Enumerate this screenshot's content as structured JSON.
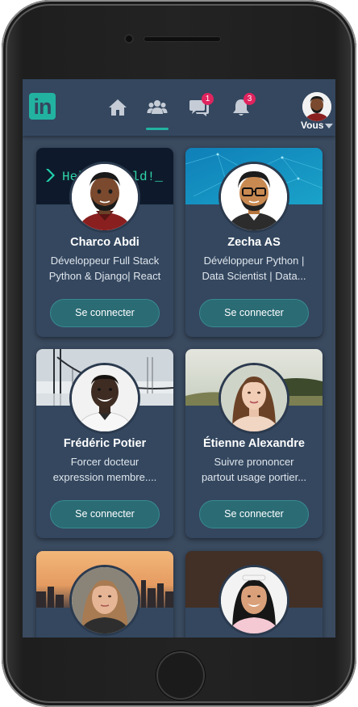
{
  "app": {
    "logo_text": "in",
    "brand_color": "#22b3a0",
    "header_bg": "#34475f"
  },
  "nav": {
    "items": [
      {
        "icon": "home-icon"
      },
      {
        "icon": "network-icon",
        "active": true
      },
      {
        "icon": "messages-icon",
        "badge": "1"
      },
      {
        "icon": "notifications-icon",
        "badge": "3"
      }
    ],
    "me_label": "Vous"
  },
  "cards": [
    {
      "name": "Charco Abdi",
      "headline_1": "Développeur Full Stack",
      "headline_2": "Python & Django| React",
      "button": "Se connecter",
      "banner_text": "Hello World!_"
    },
    {
      "name": "Zecha AS",
      "headline_1": "Dévéloppeur Python |",
      "headline_2": "Data Scientist | Data...",
      "button": "Se connecter"
    },
    {
      "name": "Frédéric Potier",
      "headline_1": "Forcer docteur",
      "headline_2": "expression membre....",
      "button": "Se connecter"
    },
    {
      "name": "Étienne Alexandre",
      "headline_1": "Suivre prononcer",
      "headline_2": "partout usage portier...",
      "button": "Se connecter"
    },
    {
      "name": "",
      "headline_1": "",
      "headline_2": "",
      "button": ""
    },
    {
      "name": "",
      "headline_1": "",
      "headline_2": "",
      "button": ""
    }
  ]
}
